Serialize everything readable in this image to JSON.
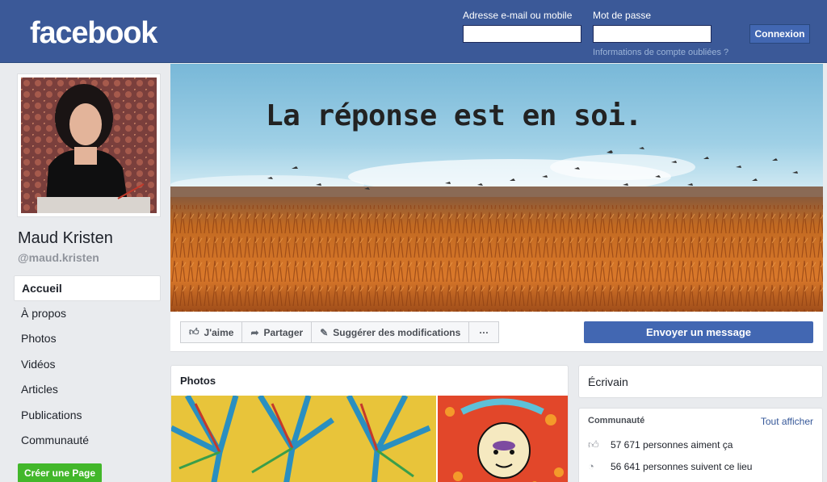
{
  "header": {
    "logo": "facebook",
    "email_label": "Adresse e-mail ou mobile",
    "email_value": "",
    "password_label": "Mot de passe",
    "password_value": "",
    "login_button": "Connexion",
    "forgot_link": "Informations de compte oubliées ?"
  },
  "profile": {
    "name": "Maud Kristen",
    "handle": "@maud.kristen"
  },
  "nav": {
    "items": [
      {
        "label": "Accueil",
        "active": true
      },
      {
        "label": "À propos"
      },
      {
        "label": "Photos"
      },
      {
        "label": "Vidéos"
      },
      {
        "label": "Articles"
      },
      {
        "label": "Publications"
      },
      {
        "label": "Communauté"
      }
    ],
    "create_page": "Créer une Page"
  },
  "cover": {
    "text": "La réponse est en soi."
  },
  "actions": {
    "like": "J'aime",
    "share": "Partager",
    "suggest": "Suggérer des modifications",
    "more": "···",
    "send_message": "Envoyer un message"
  },
  "photos": {
    "title": "Photos"
  },
  "about": {
    "category": "Écrivain"
  },
  "community": {
    "title": "Communauté",
    "see_all": "Tout afficher",
    "likes": "57 671 personnes aiment ça",
    "follows": "56 641 personnes suivent ce lieu"
  },
  "colors": {
    "brand": "#3b5998",
    "button_blue": "#4267b2",
    "green": "#42b72a",
    "link": "#365899"
  }
}
